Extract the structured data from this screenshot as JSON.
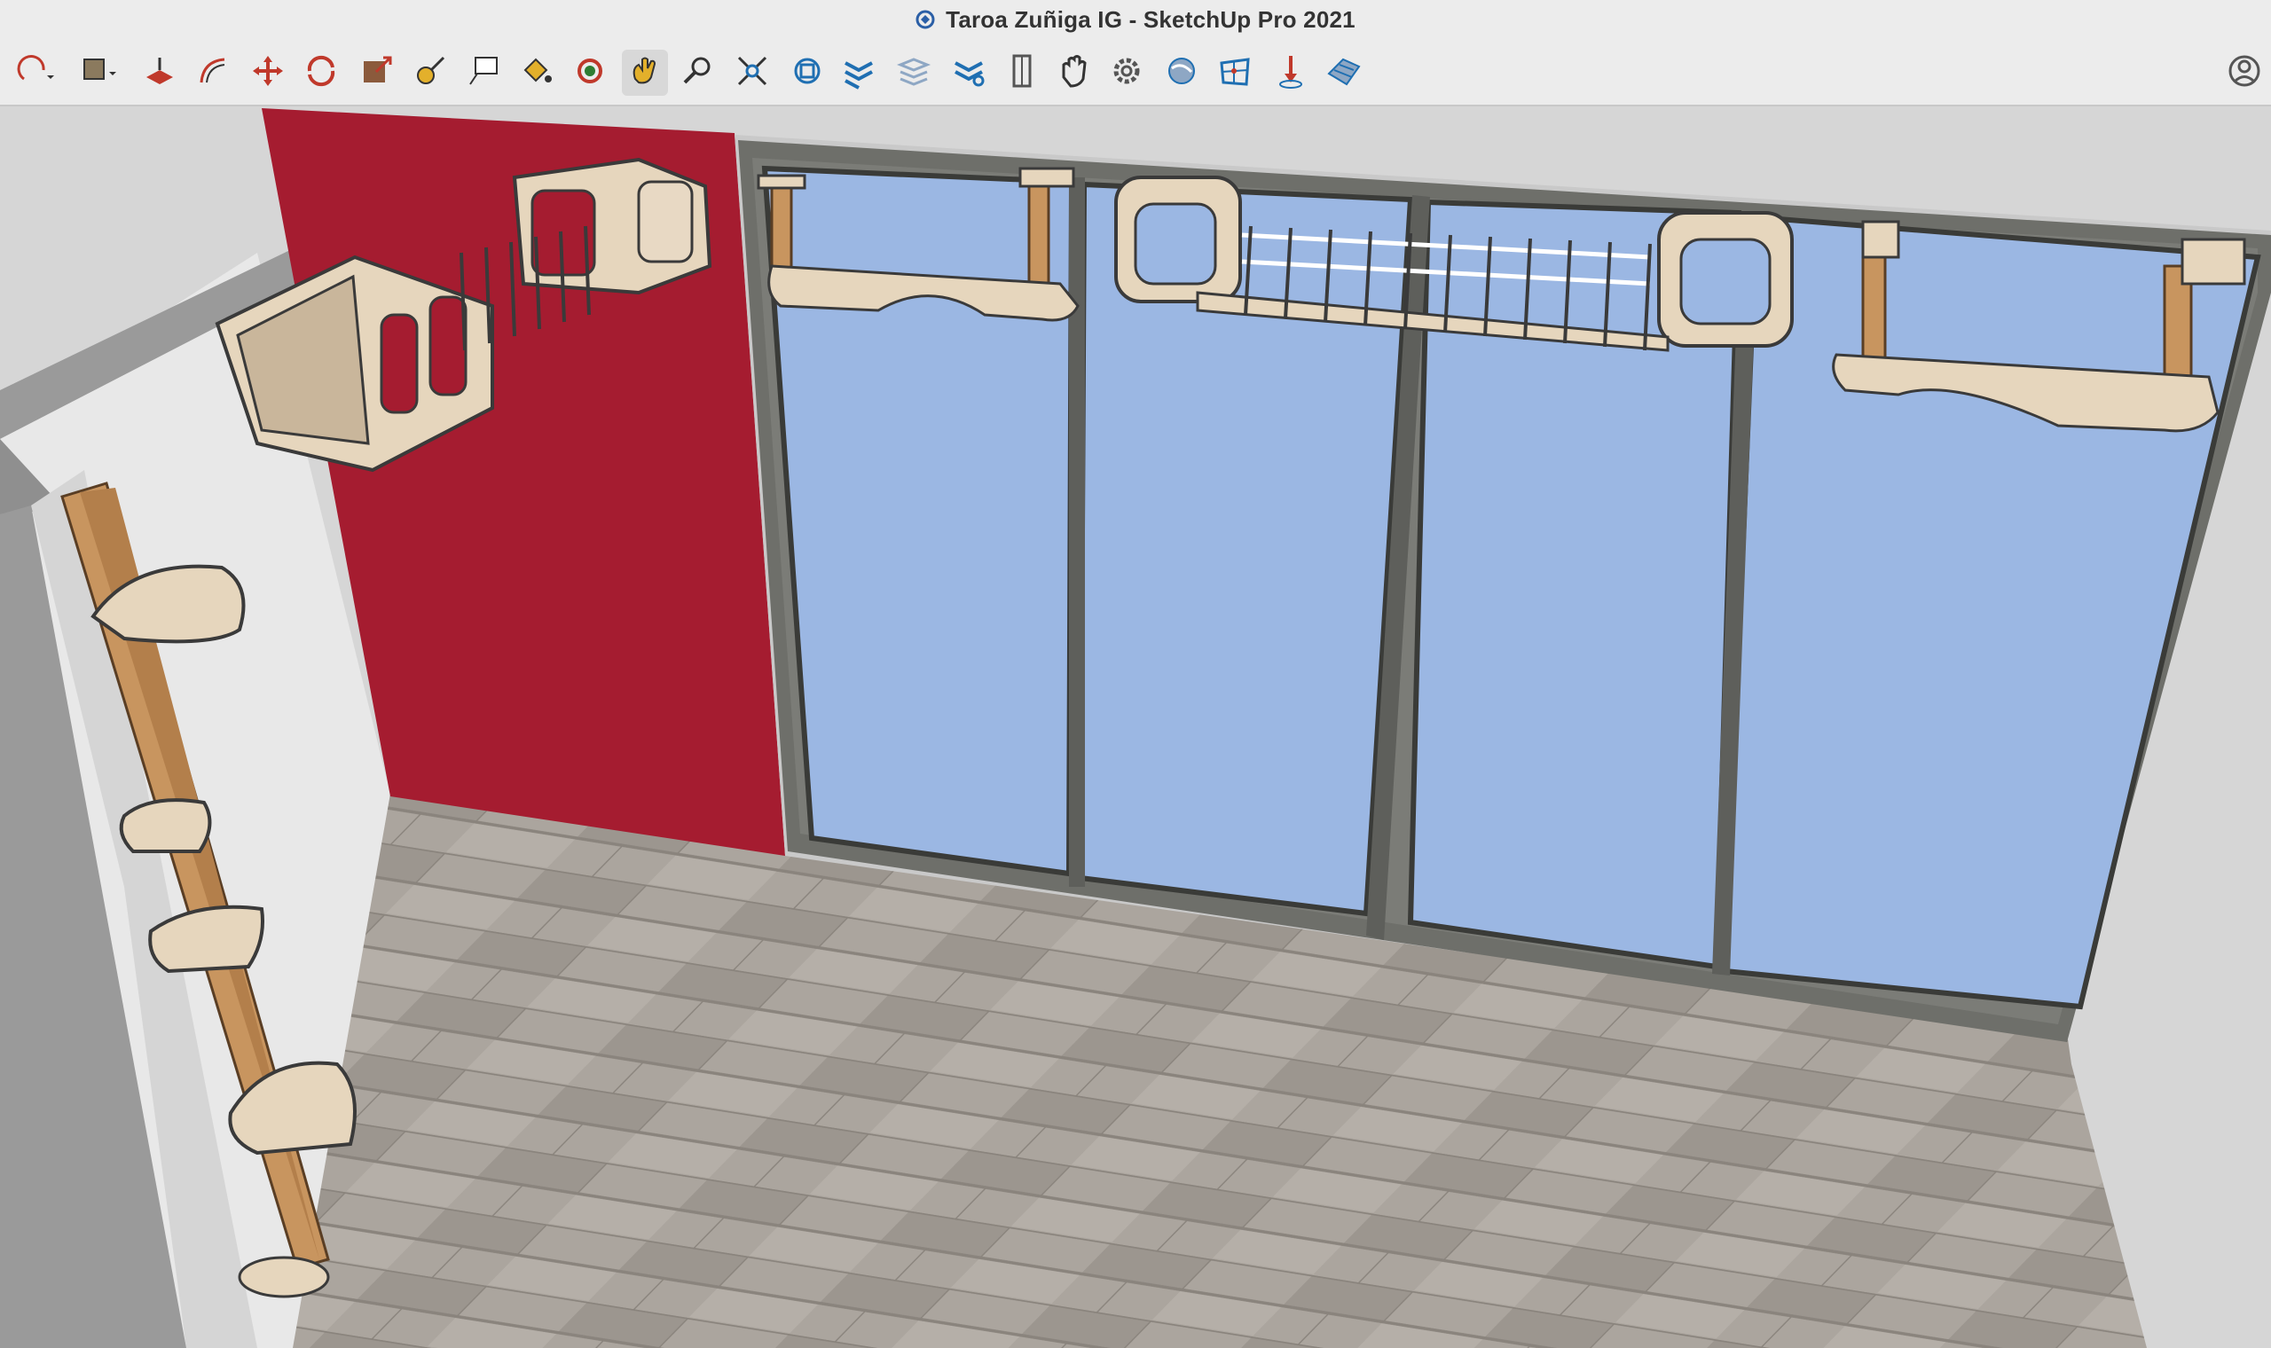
{
  "window": {
    "title": "Taroa Zuñiga IG - SketchUp Pro 2021",
    "app_icon": "sketchup-logo-icon"
  },
  "toolbar": {
    "tools": [
      {
        "name": "arc-tool-icon",
        "has_dropdown": true
      },
      {
        "name": "shapes-tool-icon",
        "has_dropdown": true
      },
      {
        "name": "push-pull-icon"
      },
      {
        "name": "offset-icon"
      },
      {
        "name": "move-icon"
      },
      {
        "name": "rotate-icon"
      },
      {
        "name": "scale-icon"
      },
      {
        "name": "tape-measure-icon"
      },
      {
        "name": "text-icon"
      },
      {
        "name": "paint-bucket-icon"
      },
      {
        "name": "orbit-icon"
      },
      {
        "name": "pan-icon",
        "active": true
      },
      {
        "name": "zoom-icon"
      },
      {
        "name": "zoom-extents-icon"
      },
      {
        "name": "3d-warehouse-icon"
      },
      {
        "name": "extension-warehouse-icon"
      },
      {
        "name": "layout-icon"
      },
      {
        "name": "extension-manager-icon"
      },
      {
        "name": "position-camera-icon"
      },
      {
        "name": "walk-icon"
      },
      {
        "name": "settings-icon"
      },
      {
        "name": "geo-location-icon"
      },
      {
        "name": "sandbox-icon"
      },
      {
        "name": "add-location-icon"
      },
      {
        "name": "terrain-icon"
      },
      {
        "name": "user-account-icon"
      }
    ]
  },
  "scene": {
    "name": "room-with-cat-shelves",
    "colors": {
      "accent_wall": "#a51c30",
      "glass": "#9bb7e3",
      "frame": "#6e6f6a",
      "floor": "#a8a39d",
      "wood": "#c8955f",
      "panel": "#e6d6bd"
    }
  }
}
